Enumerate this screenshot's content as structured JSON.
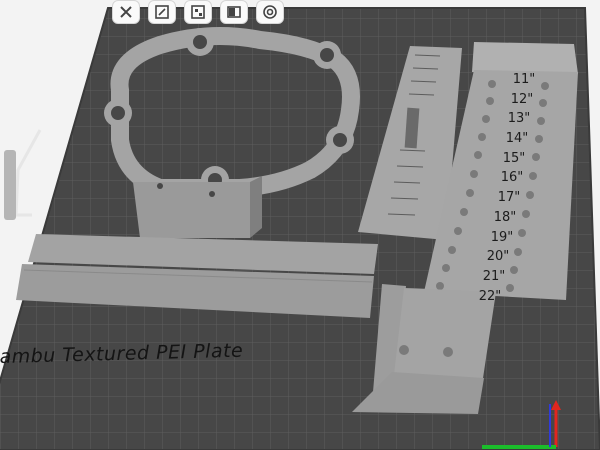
{
  "toolbar": {
    "buttons": [
      {
        "name": "close-tool",
        "icon": "close-icon"
      },
      {
        "name": "arrange-tool",
        "icon": "arrange-icon"
      },
      {
        "name": "plate-tool",
        "icon": "plate-icon"
      },
      {
        "name": "view-tool",
        "icon": "view-icon"
      },
      {
        "name": "settings-tool",
        "icon": "gear-icon"
      }
    ]
  },
  "plate": {
    "label": "Bambu Textured PEI Plate",
    "colors": {
      "surface": "#4a4a4a",
      "grid": "#5c5c5c",
      "model": "#a6a6a6"
    }
  },
  "models": {
    "ruler_labels": [
      "11\"",
      "12\"",
      "13\"",
      "14\"",
      "15\"",
      "16\"",
      "17\"",
      "18\"",
      "19\"",
      "20\"",
      "21\"",
      "22\""
    ]
  },
  "axes": {
    "x_color": "#1bbd2b",
    "y_color": "#2f3adc",
    "z_color": "#e0261f"
  }
}
